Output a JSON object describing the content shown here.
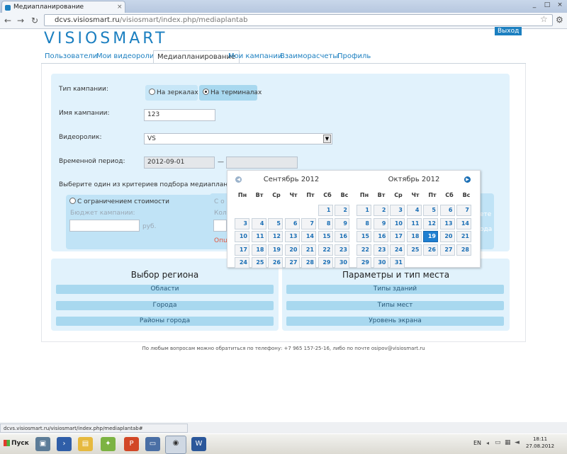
{
  "browser": {
    "tab_title": "Медиапланирование",
    "url_domain": "dcvs.visiosmart.ru",
    "url_path": "/visiosmart/index.php/mediaplantab",
    "window_controls": [
      "_",
      "□",
      "×"
    ]
  },
  "site": {
    "logo": "VISIOSMART",
    "logout": "Выход",
    "nav": [
      "Пользователи",
      "Мои видеоролики",
      "Медиапланирование",
      "Мои кампании",
      "Взаиморасчеты",
      "Профиль"
    ],
    "active_nav": "Медиапланирование"
  },
  "form": {
    "campaign_type_label": "Тип кампании:",
    "campaign_type_options": [
      "На зеркалах",
      "На терминалах"
    ],
    "campaign_type_selected": "На терминалах",
    "campaign_name_label": "Имя кампании:",
    "campaign_name_value": "123",
    "video_label": "Видеоролик:",
    "video_value": "VS",
    "period_label": "Временной период:",
    "period_start": "2012-09-01",
    "period_dash": "—",
    "period_end": "",
    "criteria_label": "Выберите один из критериев подбора медиаплана:",
    "criteria_option_1": "С ограничением стоимости",
    "budget_label": "Бюджет кампании:",
    "budget_value": "",
    "budget_unit": "руб.",
    "criteria_2_fragment": "С о",
    "criteria_2_fragment_2": "Кол",
    "criteria_2_fragment_3": "Опц",
    "criteria_3_fragment": "ете",
    "criteria_3_fragment_2": "ода"
  },
  "region": {
    "title": "Выбор региона",
    "buttons": [
      "Области",
      "Города",
      "Районы города"
    ]
  },
  "params": {
    "title": "Параметры и тип места",
    "buttons": [
      "Типы зданий",
      "Типы мест",
      "Уровень экрана"
    ]
  },
  "footer": "По любым вопросам можно обратиться по телефону: +7 965 157-25-16, либо по почте osipov@visiosmart.ru",
  "calendar": {
    "weekdays": [
      "Пн",
      "Вт",
      "Ср",
      "Чт",
      "Пт",
      "Сб",
      "Вс"
    ],
    "months": [
      {
        "title": "Сентябрь 2012",
        "first_weekday": 5,
        "days": 30,
        "selected": null
      },
      {
        "title": "Октябрь 2012",
        "first_weekday": 0,
        "days": 31,
        "selected": 19
      }
    ]
  },
  "statusbar": "dcvs.visiosmart.ru/visiosmart/index.php/mediaplantab#",
  "taskbar": {
    "start": "Пуск",
    "lang": "EN",
    "time": "18:11",
    "date": "27.08.2012"
  },
  "colors": {
    "brand": "#1b7fc0",
    "panel": "#e1f2fc",
    "selected_day": "#1f7fd1"
  }
}
